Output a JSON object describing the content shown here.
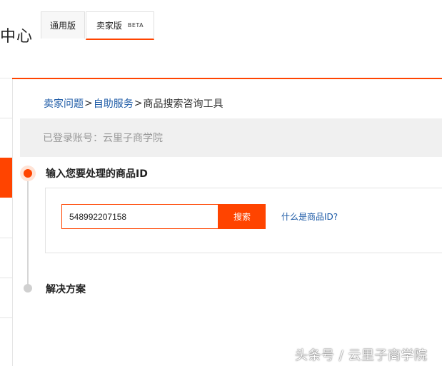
{
  "header": {
    "title_fragment": "中心",
    "tabs": [
      {
        "label": "通用版"
      },
      {
        "label": "卖家版",
        "badge": "BETA"
      }
    ]
  },
  "breadcrumb": {
    "items": [
      "卖家问题",
      "自助服务",
      "商品搜索咨询工具"
    ],
    "separator": ">"
  },
  "login_bar": {
    "text": "已登录账号：云里子商学院"
  },
  "steps": {
    "step1_title": "输入您要处理的商品ID",
    "step2_title": "解决方案"
  },
  "search": {
    "value": "548992207158",
    "button_label": "搜索",
    "help_link": "什么是商品ID?"
  },
  "watermark": "头条号 / 云里子商学院",
  "colors": {
    "accent": "#ff4400",
    "link": "#1c5aa6",
    "login_bar_bg": "#f0f0f0"
  }
}
